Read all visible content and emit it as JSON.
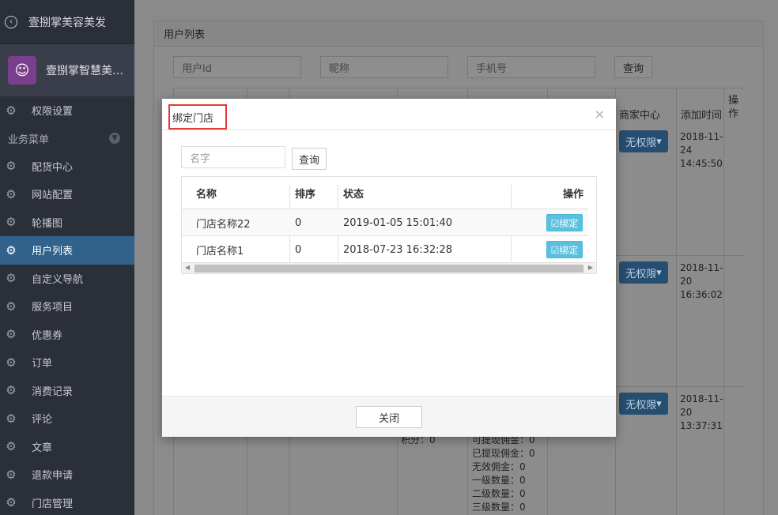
{
  "sidebar": {
    "app_title": "壹捌掌美容美发",
    "profile_name": "壹捌掌智慧美容...",
    "section_label": "业务菜单",
    "items": [
      {
        "label": "权限设置"
      },
      {
        "label": "配货中心"
      },
      {
        "label": "网站配置"
      },
      {
        "label": "轮播图"
      },
      {
        "label": "用户列表",
        "active": true
      },
      {
        "label": "自定义导航"
      },
      {
        "label": "服务项目"
      },
      {
        "label": "优惠券"
      },
      {
        "label": "订单"
      },
      {
        "label": "消费记录"
      },
      {
        "label": "评论"
      },
      {
        "label": "文章"
      },
      {
        "label": "退款申请"
      },
      {
        "label": "门店管理"
      }
    ]
  },
  "panel": {
    "title": "用户列表",
    "user_id_placeholder": "用户id",
    "nickname_placeholder": "昵称",
    "phone_placeholder": "手机号",
    "query_label": "查询",
    "col_merchant": "商家中心",
    "col_added": "添加时间",
    "col_action": "操作",
    "perm_label": "无权限",
    "dates": [
      "2018-11-24 14:45:50",
      "2018-11-20 16:36:02",
      "2018-11-20 13:37:31"
    ],
    "points_text": "积分：0",
    "commission_lines": [
      "可提现佣金：0",
      "已提现佣金：0",
      "无效佣金：0",
      "一级数量：0",
      "二级数量：0",
      "三级数量：0"
    ]
  },
  "modal": {
    "title": "绑定门店",
    "name_placeholder": "名字",
    "query_label": "查询",
    "columns": {
      "name": "名称",
      "sort": "排序",
      "status": "状态",
      "action": "操作"
    },
    "rows": [
      {
        "name": "门店名称22",
        "sort": "0",
        "status": "2019-01-05 15:01:40",
        "action": "☑绑定"
      },
      {
        "name": "门店名称1",
        "sort": "0",
        "status": "2018-07-23 16:32:28",
        "action": "☑绑定"
      }
    ],
    "close_label": "关闭"
  },
  "colors": {
    "sidebar_bg": "#2b2f3a",
    "active_item": "#30628b",
    "bind_button": "#5bc0de",
    "highlight_border": "#e53935"
  }
}
